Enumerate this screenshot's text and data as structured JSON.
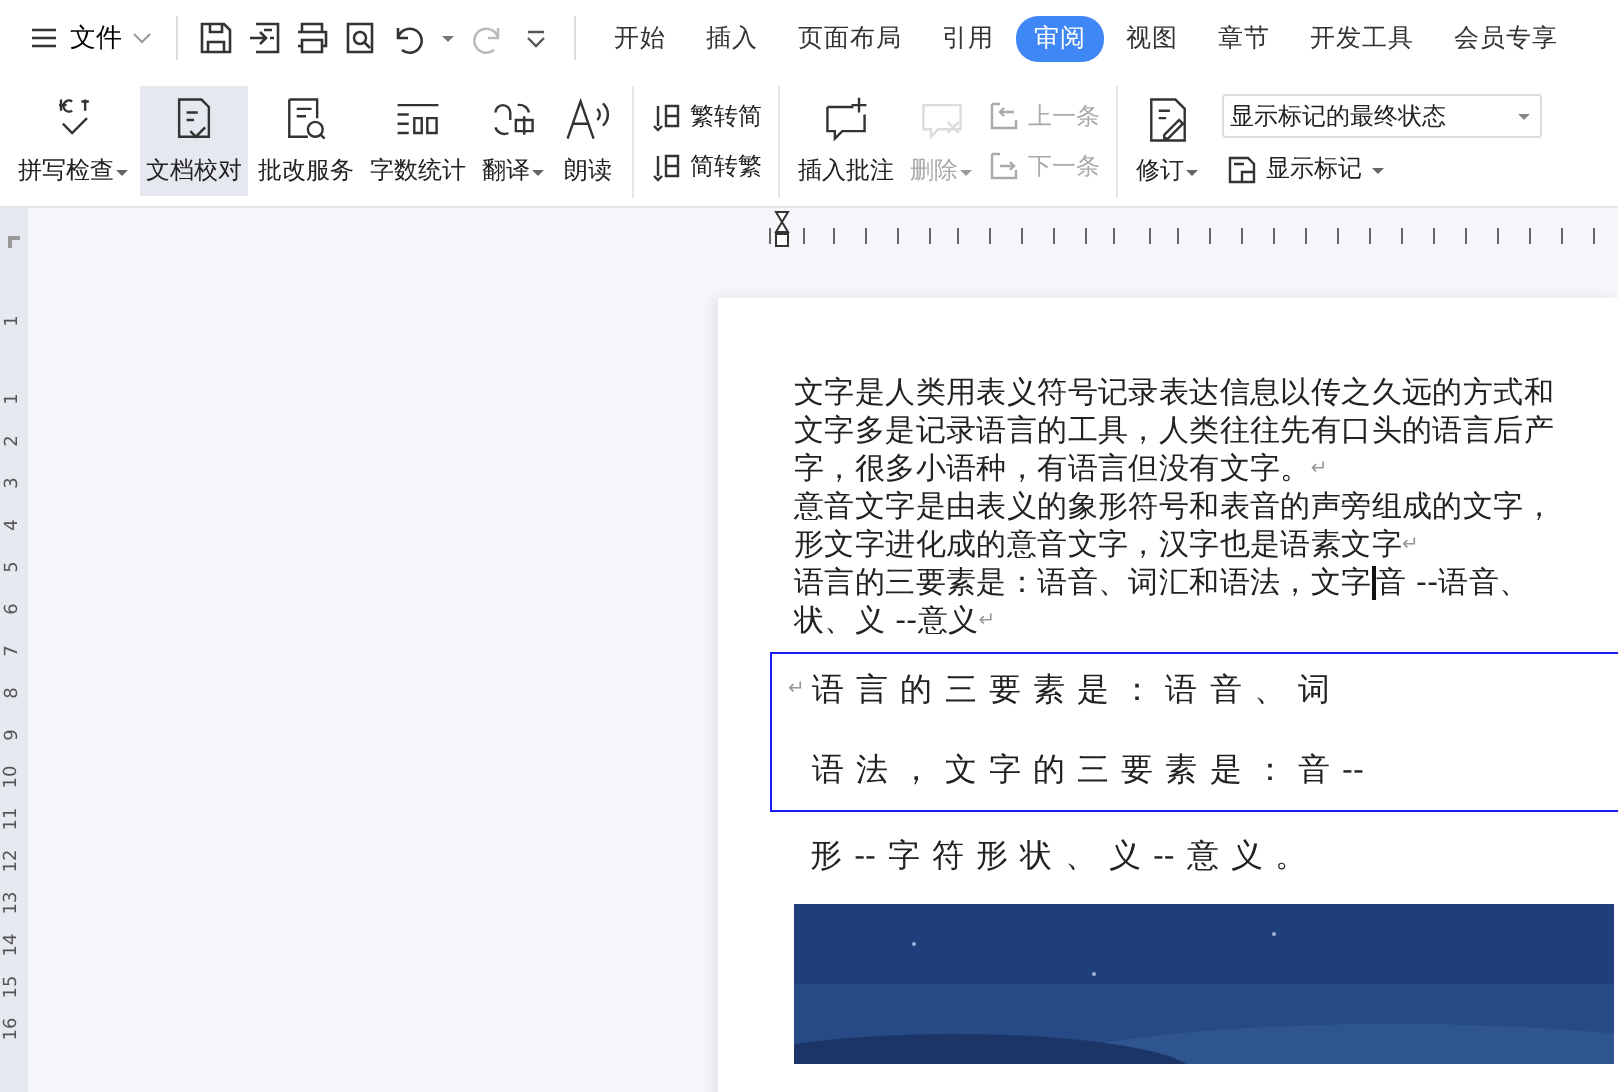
{
  "menu": {
    "label": "文件"
  },
  "tabs": [
    {
      "label": "开始",
      "selected": false
    },
    {
      "label": "插入",
      "selected": false
    },
    {
      "label": "页面布局",
      "selected": false
    },
    {
      "label": "引用",
      "selected": false
    },
    {
      "label": "审阅",
      "selected": true
    },
    {
      "label": "视图",
      "selected": false
    },
    {
      "label": "章节",
      "selected": false
    },
    {
      "label": "开发工具",
      "selected": false
    },
    {
      "label": "会员专享",
      "selected": false
    }
  ],
  "ribbon": {
    "proofing": [
      {
        "label": "拼写检查",
        "dropdown": true,
        "selected": false
      },
      {
        "label": "文档校对",
        "dropdown": false,
        "selected": true
      },
      {
        "label": "批改服务",
        "dropdown": false,
        "selected": false
      },
      {
        "label": "字数统计",
        "dropdown": false,
        "selected": false
      },
      {
        "label": "翻译",
        "dropdown": true,
        "selected": false
      },
      {
        "label": "朗读",
        "dropdown": false,
        "selected": false
      }
    ],
    "convert": [
      {
        "label": "繁转简"
      },
      {
        "label": "简转繁"
      }
    ],
    "comments": [
      {
        "label": "插入批注",
        "dropdown": false,
        "disabled": false
      },
      {
        "label": "删除",
        "dropdown": true,
        "disabled": true
      }
    ],
    "navigate": [
      {
        "label": "上一条",
        "disabled": true
      },
      {
        "label": "下一条",
        "disabled": true
      }
    ],
    "track": {
      "label": "修订"
    },
    "markup_select": {
      "value": "显示标记的最终状态"
    },
    "show_markup": {
      "label": "显示标记"
    }
  },
  "vertical_ruler": [
    "1",
    "1",
    "2",
    "3",
    "4",
    "5",
    "6",
    "7",
    "8",
    "9",
    "10",
    "11",
    "12",
    "13",
    "14",
    "15",
    "16"
  ],
  "document": {
    "paragraph_lines": [
      {
        "text": "文字是人类用表义符号记录表达信息以传之久远的方式和",
        "mark": false
      },
      {
        "text": "文字多是记录语言的工具，人类往往先有口头的语言后产",
        "mark": false
      },
      {
        "text": "字，很多小语种，有语言但没有文字。",
        "mark": true
      },
      {
        "text": "意音文字是由表义的象形符号和表音的声旁组成的文字，",
        "mark": false
      },
      {
        "text": "形文字进化成的意音文字，汉字也是语素文字",
        "mark": true
      },
      {
        "text": "语言的三要素是：语音、词汇和语法，文字",
        "after_cursor": "音 --语音、",
        "mark": false
      },
      {
        "text": "状、义 --意义",
        "mark": true
      }
    ],
    "spaced_box_lines": [
      "语 言 的 三 要 素 是 ： 语 音 、 词",
      "语 法 ， 文 字 的 三 要 素 是 ： 音 --"
    ],
    "spaced_line": "形 -- 字 符 形 状 、 义 -- 意 义 。",
    "mark_symbol": "↵"
  }
}
